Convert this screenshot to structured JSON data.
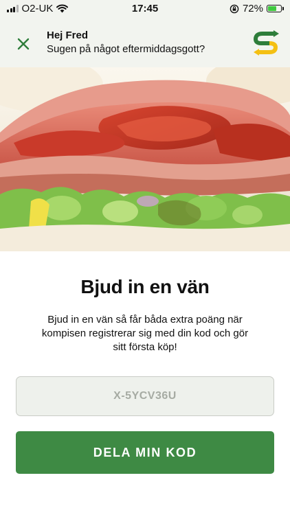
{
  "status_bar": {
    "carrier": "O2-UK",
    "time": "17:45",
    "battery": "72%",
    "battery_level": 0.72,
    "icons": [
      "signal-icon",
      "wifi-icon",
      "orientation-lock-icon",
      "battery-icon"
    ]
  },
  "header": {
    "title": "Hej Fred",
    "subtitle": "Sugen på något eftermiddagsgott?",
    "close_icon": "close-icon",
    "logo_icon": "subway-logo-icon"
  },
  "colors": {
    "brand_green": "#3e8a44",
    "logo_green": "#2e7d3a",
    "logo_yellow": "#f4c013",
    "header_bg": "#f2f4ef"
  },
  "invite": {
    "title": "Bjud in en vän",
    "description": "Bjud in en vän så får båda extra poäng när kompisen registrerar sig med din kod och gör sitt första köp!",
    "code": "X-5YCV36U",
    "share_label": "DELA MIN KOD"
  }
}
